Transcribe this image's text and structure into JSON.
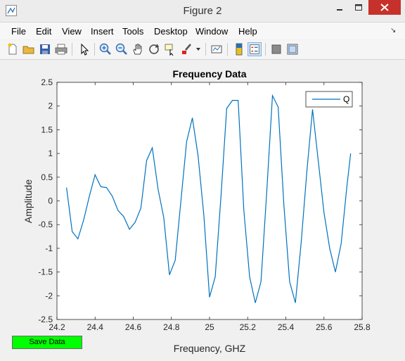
{
  "window": {
    "title": "Figure 2"
  },
  "menu": [
    "File",
    "Edit",
    "View",
    "Insert",
    "Tools",
    "Desktop",
    "Window",
    "Help"
  ],
  "chart_data": {
    "type": "line",
    "title": "Frequency Data",
    "xlabel": "Frequency, GHZ",
    "ylabel": "Amplitude",
    "xlim": [
      24.2,
      25.8
    ],
    "ylim": [
      -2.5,
      2.5
    ],
    "xticks": [
      "24.2",
      "24.4",
      "24.6",
      "24.8",
      "25",
      "25.2",
      "25.4",
      "25.6",
      "25.8"
    ],
    "yticks": [
      "2.5",
      "2",
      "1.5",
      "1",
      "0.5",
      "0",
      "-0.5",
      "-1",
      "-1.5",
      "-2",
      "-2.5"
    ],
    "grid": false,
    "legend_position": "top-right",
    "series": [
      {
        "name": "Q",
        "color": "#0072bd",
        "x": [
          24.25,
          24.28,
          24.31,
          24.34,
          24.37,
          24.4,
          24.43,
          24.46,
          24.49,
          24.52,
          24.55,
          24.58,
          24.61,
          24.64,
          24.67,
          24.7,
          24.73,
          24.76,
          24.79,
          24.82,
          24.85,
          24.88,
          24.91,
          24.94,
          24.97,
          25.0,
          25.03,
          25.06,
          25.09,
          25.12,
          25.15,
          25.18,
          25.21,
          25.24,
          25.27,
          25.3,
          25.33,
          25.36,
          25.39,
          25.42,
          25.45,
          25.48,
          25.51,
          25.54,
          25.57,
          25.6,
          25.63,
          25.66,
          25.69,
          25.72,
          25.74
        ],
        "y": [
          0.28,
          -0.65,
          -0.8,
          -0.4,
          0.1,
          0.55,
          0.3,
          0.28,
          0.1,
          -0.2,
          -0.33,
          -0.6,
          -0.45,
          -0.15,
          0.85,
          1.12,
          0.25,
          -0.35,
          -1.56,
          -1.25,
          0.0,
          1.25,
          1.75,
          0.95,
          -0.3,
          -2.03,
          -1.6,
          0.1,
          1.95,
          2.12,
          2.12,
          -0.2,
          -1.6,
          -2.15,
          -1.7,
          0.2,
          2.22,
          1.98,
          -0.1,
          -1.7,
          -2.15,
          -0.9,
          0.6,
          1.93,
          0.85,
          -0.25,
          -1.0,
          -1.5,
          -0.9,
          0.3,
          1.0
        ]
      }
    ]
  },
  "save_button": "Save Data",
  "colors": {
    "close": "#c7312b",
    "save_button": "#00ff00"
  }
}
